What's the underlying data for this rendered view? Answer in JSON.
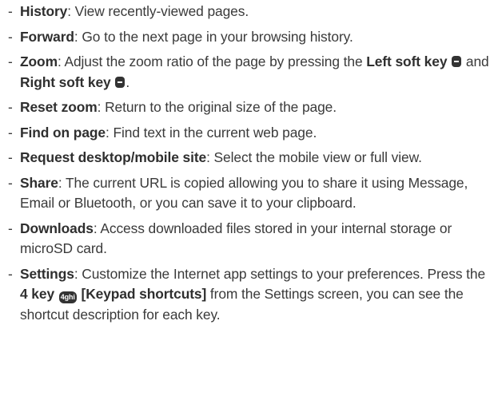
{
  "items": [
    {
      "dash": "-",
      "term": "History",
      "text": ": View recently-viewed pages."
    },
    {
      "dash": "-",
      "term": "Forward",
      "text": ": Go to the next page in your browsing history."
    },
    {
      "dash": "-",
      "term": "Zoom",
      "text_a": ": Adjust the zoom ratio of the page by pressing the ",
      "key_left": "Left soft key",
      "text_b": " and ",
      "key_right": "Right soft key",
      "text_c": "."
    },
    {
      "dash": "-",
      "term": "Reset zoom",
      "text": ": Return to the original size of the page."
    },
    {
      "dash": "-",
      "term": "Find on page",
      "text": ": Find text in the current web page."
    },
    {
      "dash": "-",
      "term": "Request desktop/mobile site",
      "text": ": Select the mobile view or full view."
    },
    {
      "dash": "-",
      "term": "Share",
      "text": ": The current URL is copied allowing you to share it using Message, Email or Bluetooth, or you can save it to your clipboard."
    },
    {
      "dash": "-",
      "term": "Downloads",
      "text": ": Access downloaded files stored in your internal storage or microSD card."
    },
    {
      "dash": "-",
      "term": "Settings",
      "text_a": ": Customize the Internet app settings to your preferences. Press the ",
      "key_4": "4 key",
      "key_4_icon": "4ghi",
      "key_shortcut": "[Keypad shortcuts]",
      "text_b": " from the Settings screen, you can see the shortcut description for each key."
    }
  ],
  "icons": {
    "soft_key_left": "left-soft-key-icon",
    "soft_key_right": "right-soft-key-icon",
    "key_4": "key-4-icon"
  }
}
